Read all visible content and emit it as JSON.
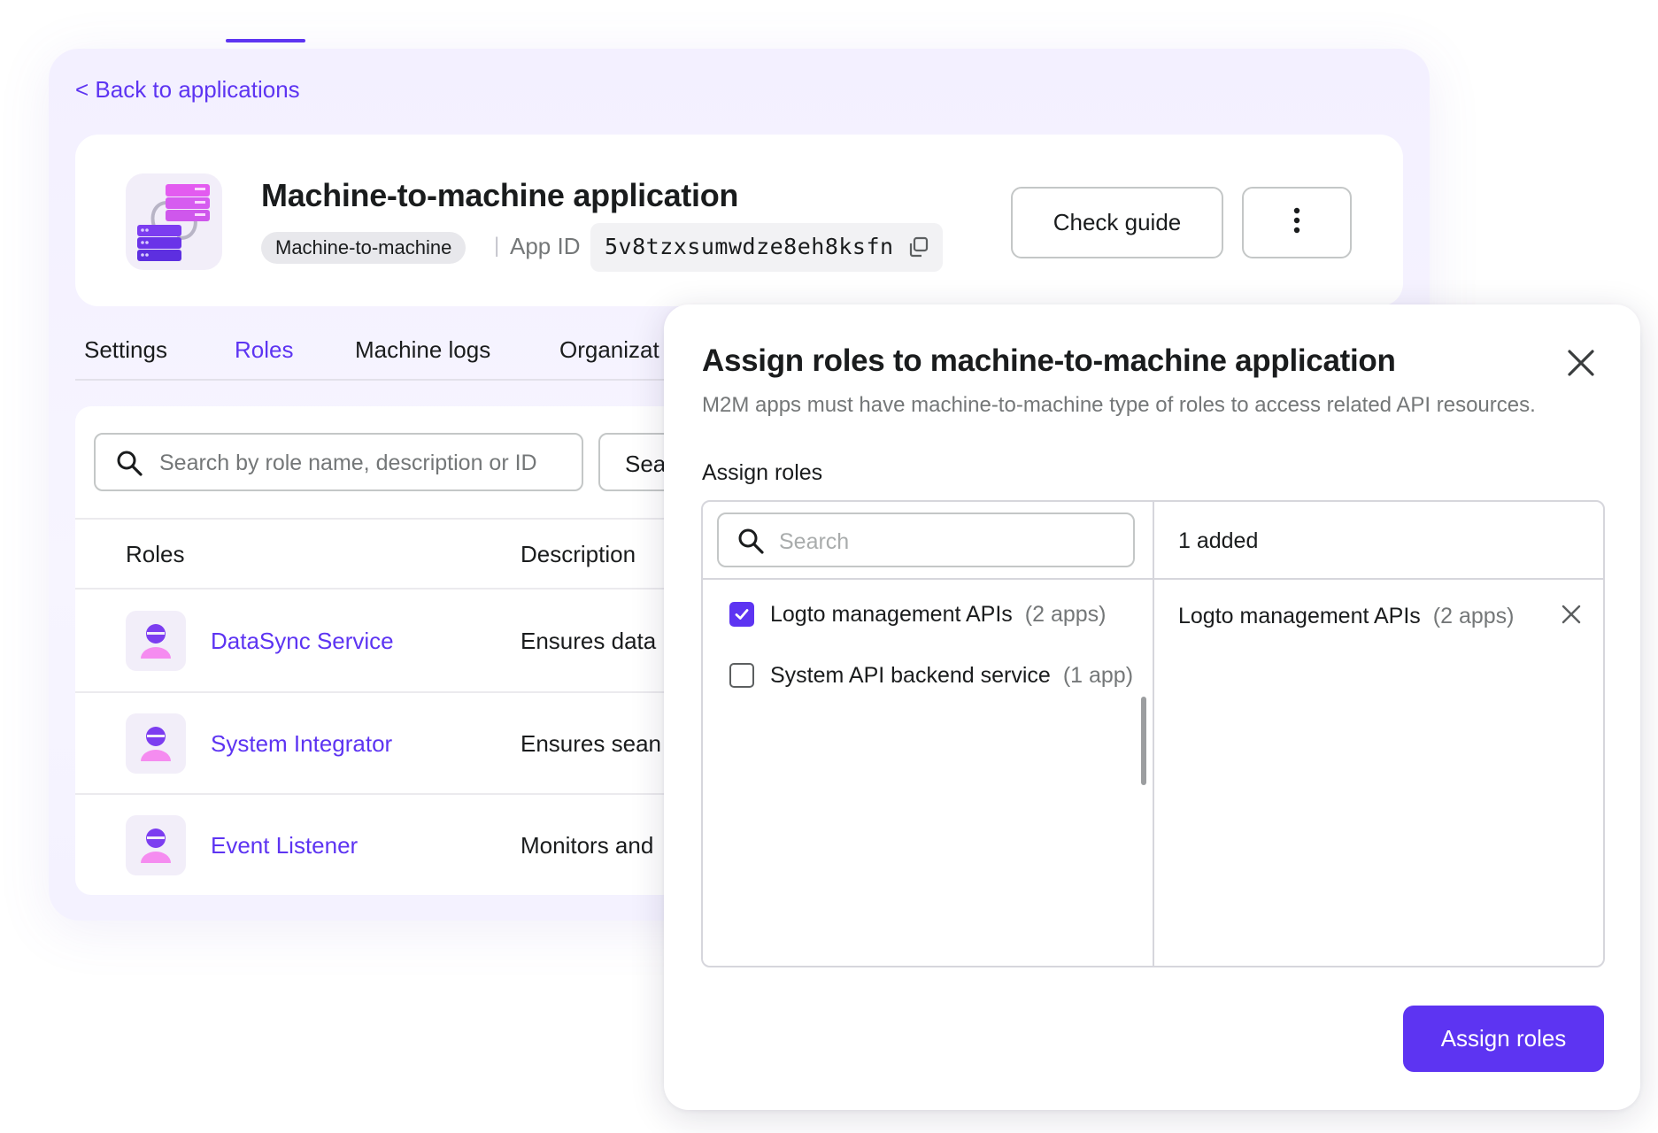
{
  "back_link": "< Back to applications",
  "app": {
    "title": "Machine-to-machine application",
    "type_chip": "Machine-to-machine",
    "separator": "|",
    "app_id_label": "App ID",
    "app_id_value": "5v8tzxsumwdze8eh8ksfn",
    "check_guide_label": "Check guide"
  },
  "tabs": [
    {
      "label": "Settings",
      "active": false
    },
    {
      "label": "Roles",
      "active": true
    },
    {
      "label": "Machine logs",
      "active": false
    },
    {
      "label": "Organizat",
      "active": false
    }
  ],
  "roles_table": {
    "search_placeholder": "Search by role name, description or ID",
    "search_button": "Sea",
    "headers": {
      "roles": "Roles",
      "description": "Description"
    },
    "rows": [
      {
        "name": "DataSync Service",
        "description": "Ensures data"
      },
      {
        "name": "System Integrator",
        "description": "Ensures  sean"
      },
      {
        "name": "Event Listener",
        "description": "Monitors and"
      }
    ]
  },
  "modal": {
    "title": "Assign roles to machine-to-machine application",
    "subtitle": "M2M apps must have machine-to-machine type of roles to access related API resources.",
    "assign_label": "Assign roles",
    "search_placeholder": "Search",
    "added_count": "1 added",
    "options": [
      {
        "name": "Logto management APIs",
        "count": "(2 apps)",
        "checked": true
      },
      {
        "name": "System API backend service",
        "count": "(1 app)",
        "checked": false
      }
    ],
    "added_items": [
      {
        "name": "Logto management APIs",
        "count": "(2 apps)"
      }
    ],
    "submit_label": "Assign roles"
  },
  "colors": {
    "accent": "#5d34f2",
    "text": "#1a1c1d",
    "muted": "#747778",
    "avatar_bg": "#f2eef9"
  }
}
